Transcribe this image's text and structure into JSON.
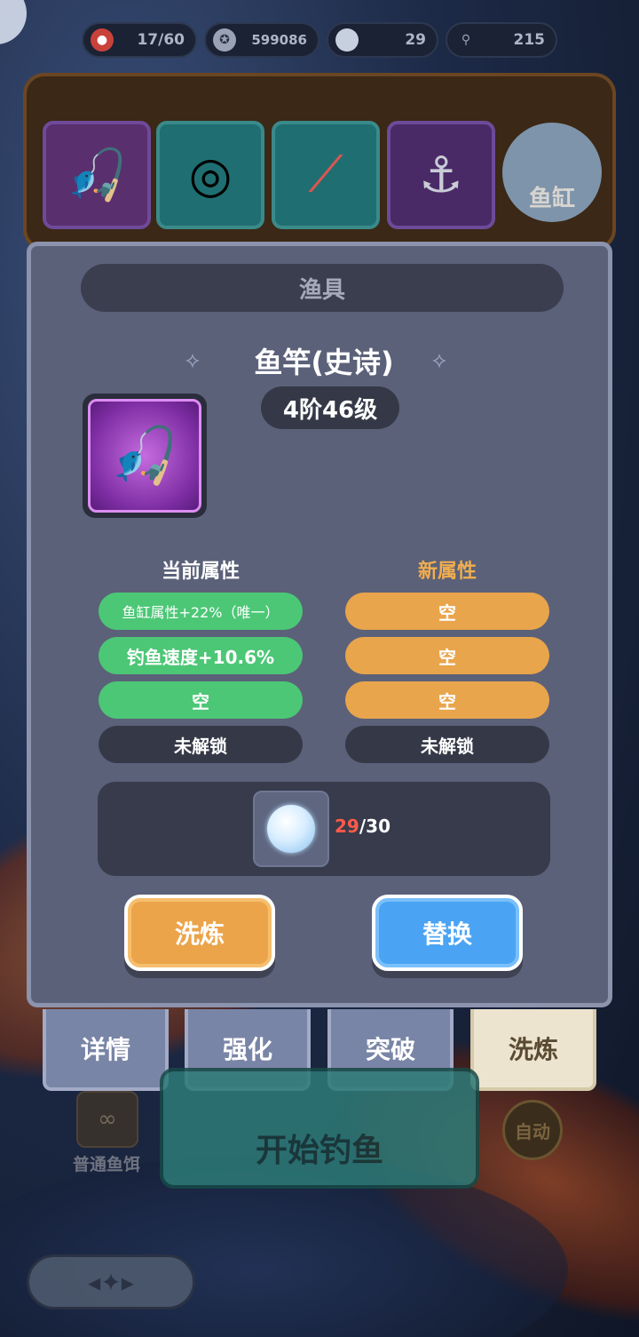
{
  "resources": [
    {
      "icon": "player-avatar-icon",
      "value": "17/60"
    },
    {
      "icon": "coin-icon",
      "value": "599086"
    },
    {
      "icon": "pearl-icon",
      "value": "29"
    },
    {
      "icon": "fishing-hook-icon",
      "value": "215"
    }
  ],
  "gear_slots": [
    {
      "icon": "fishing-rod-icon"
    },
    {
      "icon": "fishing-reel-icon"
    },
    {
      "icon": "fishing-float-icon"
    },
    {
      "icon": "fishing-hook-icon"
    }
  ],
  "fish_tank_label": "鱼缸",
  "modal": {
    "title": "渔具",
    "item_name": "鱼竿(史诗)",
    "item_level": "4阶46级",
    "current_title": "当前属性",
    "new_title": "新属性",
    "current_attrs": [
      {
        "text": "鱼缸属性+22%（唯一）",
        "state": "green"
      },
      {
        "text": "钓鱼速度+10.6%",
        "state": "green"
      },
      {
        "text": "空",
        "state": "green"
      },
      {
        "text": "未解锁",
        "state": "locked"
      }
    ],
    "new_attrs": [
      {
        "text": "空",
        "state": "orange"
      },
      {
        "text": "空",
        "state": "orange"
      },
      {
        "text": "空",
        "state": "orange"
      },
      {
        "text": "未解锁",
        "state": "locked"
      }
    ],
    "cost_have": "29",
    "cost_need": "/30",
    "refine_label": "洗炼",
    "replace_label": "替换"
  },
  "tabs": [
    {
      "label": "详情"
    },
    {
      "label": "强化"
    },
    {
      "label": "突破"
    },
    {
      "label": "洗炼",
      "active": true
    }
  ],
  "bottom": {
    "start_label": "开始钓鱼",
    "bait_label": "普通鱼饵",
    "bait_count": "∞",
    "auto_label": "自动"
  },
  "colors": {
    "modal_bg": "#5b6179",
    "attr_green": "#4cc776",
    "attr_orange": "#e9a54c",
    "attr_locked": "#353947",
    "new_title": "#f0ad4e",
    "cost_have": "#ff5a4a",
    "refine_button": "#eba44a",
    "replace_button": "#4aa4f3",
    "active_tab": "#ece4cf"
  }
}
